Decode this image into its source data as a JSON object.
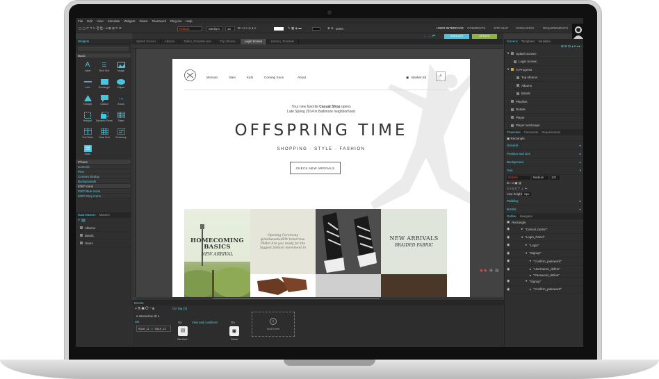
{
  "menu": [
    "File",
    "Edit",
    "View",
    "Simulate",
    "Widgets",
    "Share",
    "Teamwork",
    "Plug-ins",
    "Help"
  ],
  "toolbar": {
    "font": "Roboto",
    "weight": "Medium",
    "size": "12",
    "zoom": "100%"
  },
  "top_tabs": [
    "USER INTERFACE",
    "COMMENTS",
    "SITE MAP",
    "SCENARIOS",
    "REQUIREMENTS"
  ],
  "doc_tabs": [
    "Splash Screen",
    "Albums",
    "Tablet_Template.pwt",
    "Top Albums",
    "Login Screen",
    "Bottom_Template"
  ],
  "buttons": {
    "simulate": "SIMULATE",
    "update": "UPDATE"
  },
  "left": {
    "title": "Widgets",
    "category": "Basic",
    "widgets": [
      "Label",
      "Rich Text",
      "Image",
      "Line",
      "Rectangle",
      "Ellipse",
      "Triangle",
      "Callout",
      "Arrow",
      "Hotspot",
      "Dynamic Panel",
      "Table",
      "Text Table",
      "Data Grid",
      "Summary",
      "Index"
    ],
    "categories": [
      "iPhone",
      "Controls",
      "Pins",
      "Content display",
      "Backgrounds",
      "iOS7 Icons",
      "iOS7 Blue Icons",
      "iOS7 Grey Icons"
    ],
    "masters_tabs": [
      "Data Masters",
      "Masters"
    ],
    "masters": [
      "Albums",
      "Bands",
      "Users"
    ]
  },
  "site": {
    "nav": [
      "Woman",
      "Men",
      "Kids",
      "Coming Soon",
      "About"
    ],
    "basket": "Basket (0)",
    "intro1_pre": "Your new favorite ",
    "intro1_strong": "Casual Shop",
    "intro1_post": " opens",
    "intro2": "Late Spring 2014 in Baltimore neighborhood",
    "title": "OFFSPRING TIME",
    "subtitle": "SHOPPING  ·  STYLE  ·  FASHION",
    "cta": "CHECK NEW ARRIVALS",
    "tile1_title": "HOMECOMING BASICS",
    "tile1_sub": "NEW ARRIVAL",
    "tile2_text": "Opening Ceremony @Aoilwwekx8FW tomorrow, PMbrl Are you ready for the biggest fashion movement in",
    "tile3_title": "NEW ARRIVALS",
    "tile3_sub": "BRAIDED FABRIC"
  },
  "right": {
    "tabs": [
      "Screens",
      "Templates",
      "Variables"
    ],
    "screens": [
      "Splash Screen",
      "Login Screen",
      "In Progress",
      "Top Albums",
      "Albums",
      "Bands",
      "Playlists",
      "Details",
      "Player",
      "Player landscape"
    ],
    "props_tabs": [
      "Properties",
      "Comments",
      "Requirements"
    ],
    "widget_name": "Rectangle",
    "props": [
      "General",
      "Position and size",
      "Background",
      "Text"
    ],
    "props_font": "Roboto",
    "props_weight": "Medium",
    "props_size": "102",
    "line_height_label": "Line height",
    "line_height": "8px",
    "props2": [
      "Padding",
      "Border"
    ],
    "outline_tabs": [
      "Outline",
      "Navigator"
    ],
    "outline_root": "Rectangle",
    "outline": [
      "\"Cancel_button\"",
      "\"Login_Panel\"",
      "\"Login\"",
      "\"Signup\"",
      "\"Confirm_password\"",
      "\"Username_define\"",
      "\"Password_define\"",
      "\"Signup\"",
      "\"Confirm_password\""
    ]
  },
  "events": {
    "title": "Events",
    "on_tap": "On Tap (2)",
    "interaction": "Interaction",
    "set_label": "Set",
    "input1": "Input_11",
    "input2": "Input_12",
    "view_cond": "View add conditions",
    "go": "Go",
    "set_action": "Set Acti...",
    "show": "Show",
    "add_event": "Add Event"
  },
  "colors": {
    "accent": "#46c4e0",
    "update": "#8ab43a"
  }
}
